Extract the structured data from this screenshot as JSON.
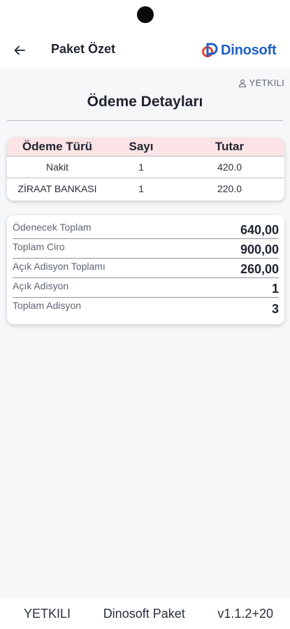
{
  "header": {
    "title": "Paket Özet",
    "brand_name": "Dinosoft",
    "brand_color": "#1d5fc7"
  },
  "user": {
    "role": "YETKILI"
  },
  "section": {
    "title": "Ödeme Detayları"
  },
  "payments": {
    "columns": [
      "Ödeme Türü",
      "Sayı",
      "Tutar"
    ],
    "header_bg": "#fce3e5",
    "rows": [
      {
        "type": "Nakit",
        "count": "1",
        "amount": "420.0"
      },
      {
        "type": "ZİRAAT BANKASI",
        "count": "1",
        "amount": "220.0"
      }
    ]
  },
  "summary": [
    {
      "label": "Ödenecek Toplam",
      "value": "640,00"
    },
    {
      "label": "Toplam Ciro",
      "value": "900,00"
    },
    {
      "label": "Açık Adisyon Toplamı",
      "value": "260,00"
    },
    {
      "label": "Açık Adisyon",
      "value": "1"
    },
    {
      "label": "Toplam Adisyon",
      "value": "3"
    }
  ],
  "footer": {
    "role": "YETKILI",
    "app_name": "Dinosoft Paket",
    "version": "v1.1.2+20"
  },
  "icons": {
    "back": "arrow-left-icon",
    "user": "person-icon",
    "logo": "dinosoft-logo-icon"
  }
}
